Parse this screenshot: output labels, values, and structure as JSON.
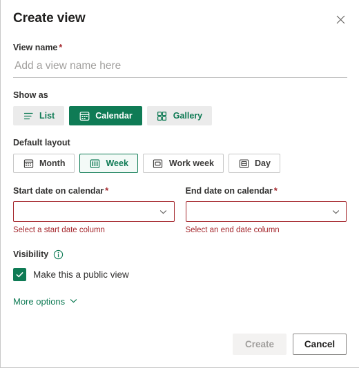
{
  "dialog": {
    "title": "Create view",
    "close_icon": "close-icon"
  },
  "view_name": {
    "label": "View name",
    "required_marker": "*",
    "value": "",
    "placeholder": "Add a view name here"
  },
  "show_as": {
    "label": "Show as",
    "selected": "Calendar",
    "options": [
      {
        "label": "List",
        "icon": "list-icon",
        "selected": false
      },
      {
        "label": "Calendar",
        "icon": "calendar-icon",
        "selected": true
      },
      {
        "label": "Gallery",
        "icon": "gallery-icon",
        "selected": false
      }
    ]
  },
  "default_layout": {
    "label": "Default layout",
    "selected": "Week",
    "options": [
      {
        "label": "Month",
        "icon": "calendar-month-icon",
        "selected": false
      },
      {
        "label": "Week",
        "icon": "calendar-week-icon",
        "selected": true
      },
      {
        "label": "Work week",
        "icon": "calendar-workweek-icon",
        "selected": false
      },
      {
        "label": "Day",
        "icon": "calendar-day-icon",
        "selected": false
      }
    ]
  },
  "start_date": {
    "label": "Start date on calendar",
    "required_marker": "*",
    "value": "",
    "error": "Select a start date column",
    "chevron_icon": "chevron-down-icon"
  },
  "end_date": {
    "label": "End date on calendar",
    "required_marker": "*",
    "value": "",
    "error": "Select an end date column",
    "chevron_icon": "chevron-down-icon"
  },
  "visibility": {
    "label": "Visibility",
    "info_icon": "info-icon",
    "checkbox_label": "Make this a public view",
    "checked": true
  },
  "more_options": {
    "label": "More options",
    "chevron_icon": "chevron-down-icon"
  },
  "footer": {
    "create_label": "Create",
    "create_disabled": true,
    "cancel_label": "Cancel"
  },
  "colors": {
    "accent_green": "#0f7b55",
    "error_red": "#a4262c",
    "text_primary": "#201f1e",
    "disabled_text": "#a19f9d"
  }
}
